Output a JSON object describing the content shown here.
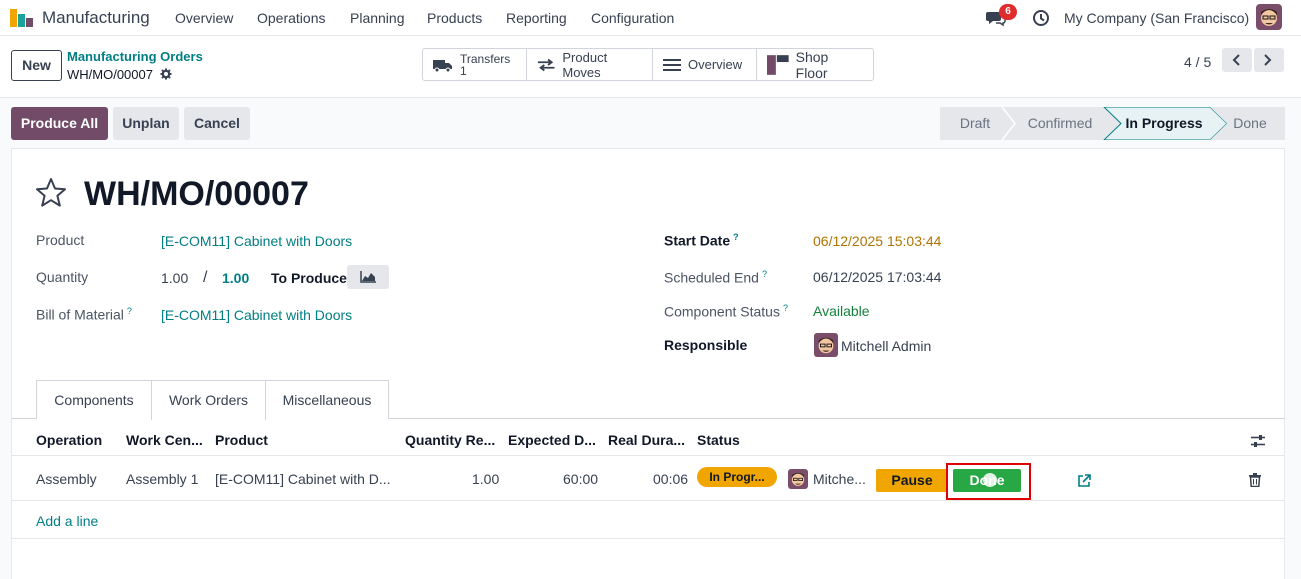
{
  "navbar": {
    "app_title": "Manufacturing",
    "menu": [
      "Overview",
      "Operations",
      "Planning",
      "Products",
      "Reporting",
      "Configuration"
    ],
    "chat_count": "6",
    "company": "My Company (San Francisco)"
  },
  "control_panel": {
    "new_label": "New",
    "breadcrumb_parent": "Manufacturing Orders",
    "breadcrumb_current": "WH/MO/00007",
    "smart_buttons": {
      "transfers_label": "Transfers",
      "transfers_count": "1",
      "product_moves": "Product Moves",
      "overview": "Overview",
      "shop_floor": "Shop Floor"
    },
    "pager": "4 / 5"
  },
  "actions": {
    "produce_all": "Produce All",
    "unplan": "Unplan",
    "cancel": "Cancel"
  },
  "status_stages": [
    "Draft",
    "Confirmed",
    "In Progress",
    "Done"
  ],
  "status_current": "In Progress",
  "form": {
    "name": "WH/MO/00007",
    "product_label": "Product",
    "product_value": "[E-COM11] Cabinet with Doors",
    "quantity_label": "Quantity",
    "quantity_produced": "1.00",
    "quantity_sep": "/",
    "quantity_to_produce": "1.00",
    "to_produce_label": "To Produce",
    "bom_label": "Bill of Material",
    "bom_help": "?",
    "bom_value": "[E-COM11] Cabinet with Doors",
    "start_date_label": "Start Date",
    "start_date_help": "?",
    "start_date_value": "06/12/2025 15:03:44",
    "scheduled_end_label": "Scheduled End",
    "scheduled_end_help": "?",
    "scheduled_end_value": "06/12/2025 17:03:44",
    "component_status_label": "Component Status",
    "component_status_help": "?",
    "component_status_value": "Available",
    "responsible_label": "Responsible",
    "responsible_value": "Mitchell Admin"
  },
  "tabs": [
    "Components",
    "Work Orders",
    "Miscellaneous"
  ],
  "active_tab": "Work Orders",
  "work_orders": {
    "columns": [
      "Operation",
      "Work Cen...",
      "Product",
      "Quantity Re...",
      "Expected D...",
      "Real Dura...",
      "Status"
    ],
    "rows": [
      {
        "operation": "Assembly",
        "work_center": "Assembly 1",
        "product": "[E-COM11] Cabinet with D...",
        "quantity": "1.00",
        "expected_duration": "60:00",
        "real_duration": "00:06",
        "status": "In Progr...",
        "user": "Mitche...",
        "pause_label": "Pause",
        "done_label": "Done"
      }
    ],
    "add_line": "Add a line"
  },
  "colors": {
    "brand": "#714b67",
    "link": "#017e84",
    "warning": "#f0a500",
    "success": "#28a745",
    "badge": "#e02c2c"
  },
  "icons": [
    "manufacturing-app-icon",
    "chat-icon",
    "clock-icon",
    "gear-icon",
    "truck-icon",
    "arrows-icon",
    "list-icon",
    "shop-floor-icon",
    "chevron-left-icon",
    "chevron-right-icon",
    "star-icon",
    "area-chart-icon",
    "settings-sliders-icon",
    "external-link-icon",
    "trash-icon"
  ]
}
